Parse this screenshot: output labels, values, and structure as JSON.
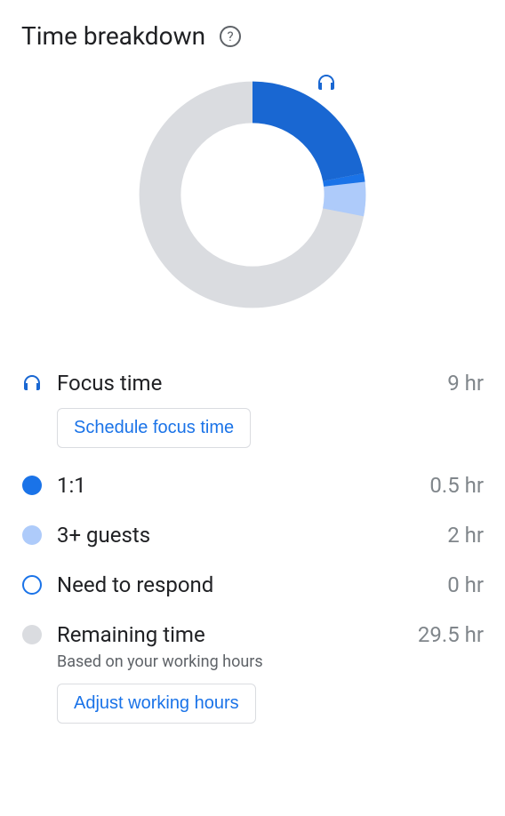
{
  "title": "Time breakdown",
  "chart_data": {
    "type": "pie",
    "title": "Time breakdown",
    "series": [
      {
        "name": "Focus time",
        "value": 9,
        "color": "#1967d2"
      },
      {
        "name": "1:1",
        "value": 0.5,
        "color": "#1a73e8"
      },
      {
        "name": "3+ guests",
        "value": 2,
        "color": "#aecbfa"
      },
      {
        "name": "Need to respond",
        "value": 0,
        "color": "#ffffff"
      },
      {
        "name": "Remaining time",
        "value": 29.5,
        "color": "#dadce0"
      }
    ],
    "total": 41,
    "unit": "hr"
  },
  "legend": {
    "focus": {
      "label": "Focus time",
      "value": "9 hr",
      "color": "#1967d2",
      "action": "Schedule focus time"
    },
    "oneonone": {
      "label": "1:1",
      "value": "0.5 hr",
      "color": "#1a73e8"
    },
    "guests": {
      "label": "3+ guests",
      "value": "2 hr",
      "color": "#aecbfa"
    },
    "respond": {
      "label": "Need to respond",
      "value": "0 hr",
      "color": "#1a73e8"
    },
    "remaining": {
      "label": "Remaining time",
      "value": "29.5 hr",
      "sublabel": "Based on your working hours",
      "color": "#dadce0",
      "action": "Adjust working hours"
    }
  }
}
